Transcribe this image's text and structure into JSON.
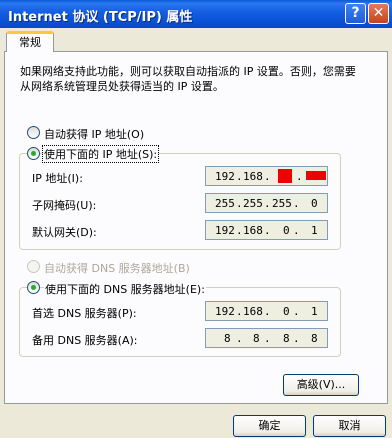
{
  "window": {
    "title": "Internet 协议 (TCP/IP) 属性",
    "help_glyph": "?",
    "close_glyph": "✕"
  },
  "tab": {
    "label": "常规"
  },
  "description": "如果网络支持此功能，则可以获取自动指派的 IP 设置。否则，您需要从网络系统管理员处获得适当的 IP 设置。",
  "ip_section": {
    "auto_label": "自动获得 IP 地址(O)",
    "manual_label": "使用下面的 IP 地址(S):",
    "selected": "manual",
    "fields": [
      {
        "label": "IP 地址(I):",
        "octets": [
          "192",
          "168",
          "",
          ""
        ],
        "redacted": true
      },
      {
        "label": "子网掩码(U):",
        "octets": [
          "255",
          "255",
          "255",
          "0"
        ]
      },
      {
        "label": "默认网关(D):",
        "octets": [
          "192",
          "168",
          "0",
          "1"
        ]
      }
    ]
  },
  "dns_section": {
    "auto_label": "自动获得 DNS 服务器地址(B)",
    "manual_label": "使用下面的 DNS 服务器地址(E):",
    "selected": "manual",
    "fields": [
      {
        "label": "首选 DNS 服务器(P):",
        "octets": [
          "192",
          "168",
          "0",
          "1"
        ]
      },
      {
        "label": "备用 DNS 服务器(A):",
        "octets": [
          "8",
          "8",
          "8",
          "8"
        ]
      }
    ]
  },
  "buttons": {
    "advanced": "高级(V)...",
    "ok": "确定",
    "cancel": "取消"
  },
  "colors": {
    "titlebar": "#0b52d6",
    "dialog_bg": "#ece9d8",
    "radio_check": "#2fa62f",
    "redaction": "#ee0000"
  }
}
